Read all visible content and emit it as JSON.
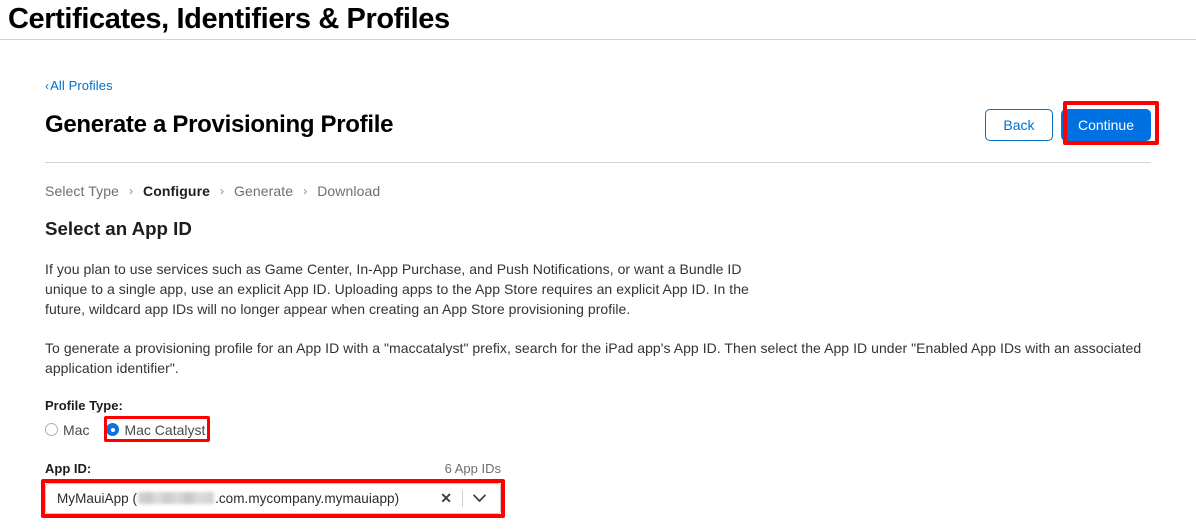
{
  "page": {
    "title": "Certificates, Identifiers & Profiles"
  },
  "breadcrumb": {
    "back_chevron": "‹",
    "back_label": "All Profiles"
  },
  "header": {
    "section_title": "Generate a Provisioning Profile",
    "back_button": "Back",
    "continue_button": "Continue"
  },
  "steps": [
    {
      "label": "Select Type",
      "active": false
    },
    {
      "label": "Configure",
      "active": true
    },
    {
      "label": "Generate",
      "active": false
    },
    {
      "label": "Download",
      "active": false
    }
  ],
  "step_separator": "›",
  "main": {
    "sub_title": "Select an App ID",
    "paragraph_1": "If you plan to use services such as Game Center, In-App Purchase, and Push Notifications, or want a Bundle ID unique to a single app, use an explicit App ID. Uploading apps to the App Store requires an explicit App ID. In the future, wildcard app IDs will no longer appear when creating an App Store provisioning profile.",
    "paragraph_2": "To generate a provisioning profile for an App ID with a \"maccatalyst\" prefix, search for the iPad app's App ID. Then select the App ID under \"Enabled App IDs with an associated application identifier\"."
  },
  "profile_type": {
    "label": "Profile Type:",
    "options": [
      {
        "label": "Mac",
        "selected": false
      },
      {
        "label": "Mac Catalyst",
        "selected": true
      }
    ]
  },
  "app_id": {
    "label": "App ID:",
    "count_label": "6 App IDs",
    "selected_prefix": "MyMauiApp (",
    "selected_suffix": ".com.mycompany.mymauiapp)",
    "clear_icon": "✕",
    "chevron_icon": "chevron-down-icon"
  },
  "colors": {
    "accent_blue": "#0071e3",
    "link_blue": "#0070c9",
    "highlight_red": "#ff0000",
    "rule_gray": "#d2d2d7"
  }
}
